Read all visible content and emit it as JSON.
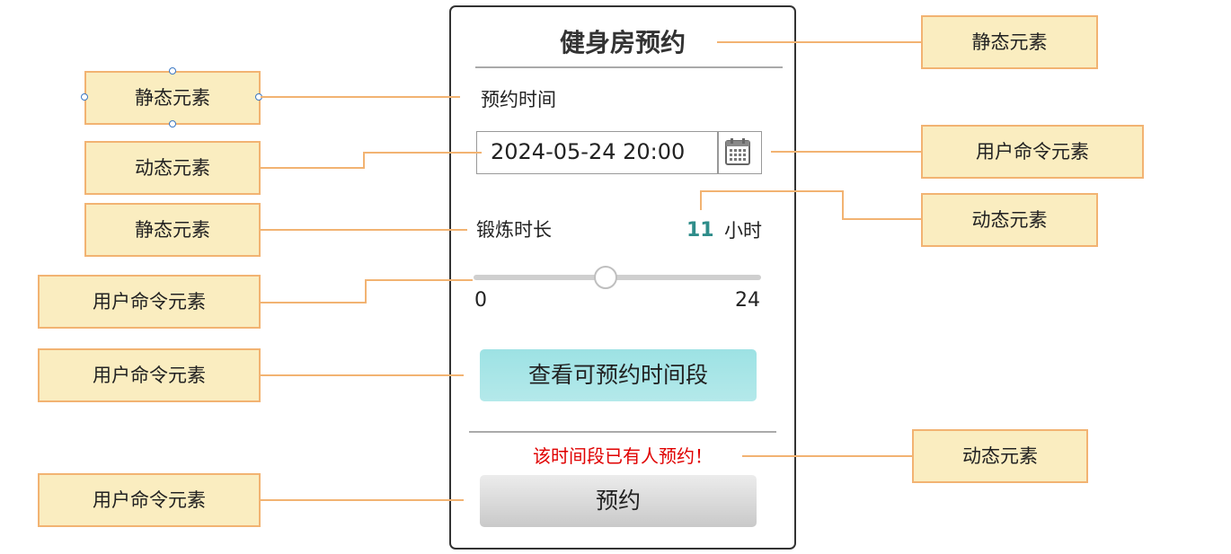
{
  "app": {
    "title": "健身房预约",
    "time_label": "预约时间",
    "datetime_value": "2024-05-24 20:00",
    "calendar_icon": "calendar-icon",
    "duration_label": "锻炼时长",
    "duration_value": "11",
    "duration_unit": "小时",
    "slider": {
      "min_label": "0",
      "max_label": "24",
      "value": 11,
      "min": 0,
      "max": 24
    },
    "check_button": "查看可预约时间段",
    "warning": "该时间段已有人预约！",
    "book_button": "预约",
    "warning_color": "#e00000",
    "accent_color": "#2f8d8a"
  },
  "annotations": {
    "left": [
      {
        "label": "静态元素"
      },
      {
        "label": "动态元素"
      },
      {
        "label": "静态元素"
      },
      {
        "label": "用户命令元素"
      },
      {
        "label": "用户命令元素"
      },
      {
        "label": "用户命令元素"
      }
    ],
    "right": [
      {
        "label": "静态元素"
      },
      {
        "label": "用户命令元素"
      },
      {
        "label": "动态元素"
      },
      {
        "label": "动态元素"
      }
    ]
  },
  "colors": {
    "annotation_fill": "#faedc0",
    "annotation_border": "#f2b372"
  }
}
